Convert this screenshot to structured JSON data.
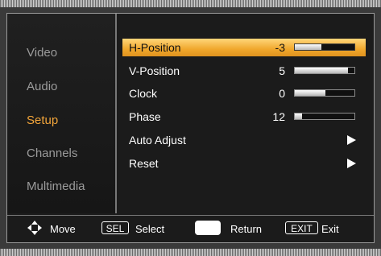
{
  "left_menu": {
    "items": [
      {
        "label": "Video",
        "active": false
      },
      {
        "label": "Audio",
        "active": false
      },
      {
        "label": "Setup",
        "active": true
      },
      {
        "label": "Channels",
        "active": false
      },
      {
        "label": "Multimedia",
        "active": false
      }
    ]
  },
  "setup_menu": {
    "items": [
      {
        "label": "H-Position",
        "value": "-3",
        "level": 0.45,
        "selected": true
      },
      {
        "label": "V-Position",
        "value": "5",
        "level": 0.89,
        "selected": false
      },
      {
        "label": "Clock",
        "value": "0",
        "level": 0.51,
        "selected": false
      },
      {
        "label": "Phase",
        "value": "12",
        "level": 0.12,
        "selected": false
      },
      {
        "label": "Auto Adjust",
        "selected": false,
        "icon": "right-arrow-icon"
      },
      {
        "label": "Reset",
        "selected": false,
        "icon": "right-arrow-icon"
      }
    ]
  },
  "hints": {
    "move_label": "Move",
    "sel_key": "SEL",
    "select_label": "Select",
    "return_label": "Return",
    "exit_key": "EXIT",
    "exit_label": "Exit"
  },
  "colors": {
    "accent": "#f2a53a",
    "selected_row": "#f0a72c",
    "inactive_text": "#9b9b9b"
  }
}
